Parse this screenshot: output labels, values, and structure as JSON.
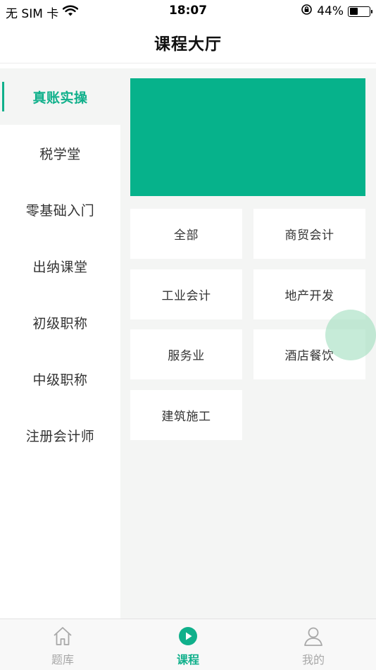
{
  "status_bar": {
    "carrier": "无 SIM 卡",
    "time": "18:07",
    "battery_percent": "44%",
    "battery_level": 0.44
  },
  "nav": {
    "title": "课程大厅"
  },
  "sidebar": {
    "items": [
      {
        "label": "真账实操",
        "active": true
      },
      {
        "label": "税学堂",
        "active": false
      },
      {
        "label": "零基础入门",
        "active": false
      },
      {
        "label": "出纳课堂",
        "active": false
      },
      {
        "label": "初级职称",
        "active": false
      },
      {
        "label": "中级职称",
        "active": false
      },
      {
        "label": "注册会计师",
        "active": false
      }
    ]
  },
  "main": {
    "banner_color": "#06b28b",
    "categories": [
      "全部",
      "商贸会计",
      "工业会计",
      "地产开发",
      "服务业",
      "酒店餐饮",
      "建筑施工"
    ]
  },
  "tab_bar": {
    "tabs": [
      {
        "label": "题库",
        "icon": "home-icon",
        "active": false
      },
      {
        "label": "课程",
        "icon": "play-circle-icon",
        "active": true
      },
      {
        "label": "我的",
        "icon": "user-icon",
        "active": false
      }
    ]
  },
  "colors": {
    "accent": "#10b08b",
    "background": "#f4f5f4",
    "inactive_text": "#a8a8a8"
  }
}
